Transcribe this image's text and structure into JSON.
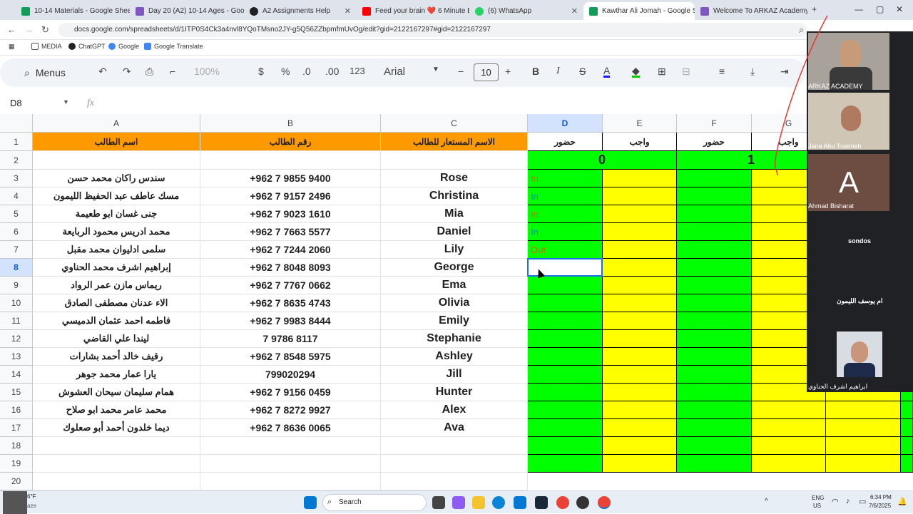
{
  "browser": {
    "tabs": [
      {
        "title": "10-14 Materials - Google Sheets",
        "color": "#0f9d58"
      },
      {
        "title": "Day 20 (A2) 10-14 Ages - Google",
        "color": "#7e57c2"
      },
      {
        "title": "A2 Assignments Help",
        "color": "#222222"
      },
      {
        "title": "Feed your brain ❤️ 6 Minute E",
        "color": "#ff0000"
      },
      {
        "title": "(6) WhatsApp",
        "color": "#25d366"
      },
      {
        "title": "Kawthar Ali Jomah - Google Sh",
        "color": "#0f9d58"
      },
      {
        "title": "Welcome To ARKAZ Academy",
        "color": "#7e57c2"
      }
    ],
    "url": "docs.google.com/spreadsheets/d/1ITP0S4Ck3a4nvl8YQoTMsno2JY-g5Q56ZZbpmfmUvOg/edit?gid=2122167297#gid=2122167297",
    "bookmarks": [
      "MEDIA",
      "ChatGPT",
      "Google",
      "Google Translate"
    ]
  },
  "toolbar": {
    "menus": "Menus",
    "zoom": "100%",
    "currency": "$",
    "percent": "%",
    "dec_less": ".0",
    "dec_more": ".00",
    "format123": "123",
    "font": "Arial",
    "font_size": "10"
  },
  "formula_bar": {
    "name_box": "D8",
    "fx": "fx"
  },
  "columns": [
    "A",
    "B",
    "C",
    "D",
    "E",
    "F",
    "G"
  ],
  "header_row": {
    "a": "اسم الطالب",
    "b": "رقم الطالب",
    "c": "الاسم المستعار للطالب",
    "d": "حضور",
    "e": "واجب",
    "f": "حضور",
    "g": "واجب"
  },
  "row2": {
    "session_0": "0",
    "session_1": "1"
  },
  "rows": [
    {
      "num": "3",
      "name": "سندس راكان محمد حسن",
      "phone": "+962 7 9855 9400",
      "nick": "Rose",
      "att": "In"
    },
    {
      "num": "4",
      "name": "مسك عاطف عبد الحفيظ الليمون",
      "phone": "+962 7 9157 2496",
      "nick": "Christina",
      "att": "In"
    },
    {
      "num": "5",
      "name": "جنى غسان ابو طعيمة",
      "phone": "+962 7 9023 1610",
      "nick": "Mia",
      "att": "In"
    },
    {
      "num": "6",
      "name": "محمد ادريس محمود الربايعة",
      "phone": "+962 7 7663 5577",
      "nick": "Daniel",
      "att": "In"
    },
    {
      "num": "7",
      "name": "سلمى ادليوان محمد مقبل",
      "phone": "+962 7 7244 2060",
      "nick": "Lily",
      "att": "Out"
    },
    {
      "num": "8",
      "name": "إبراهيم اشرف محمد الحناوي",
      "phone": "+962 7 8048 8093",
      "nick": "George",
      "att": ""
    },
    {
      "num": "9",
      "name": "ريماس مازن عمر الرواد",
      "phone": "+962 7 7767 0662",
      "nick": "Ema",
      "att": ""
    },
    {
      "num": "10",
      "name": "الاء عدنان مصطفى الصادق",
      "phone": "+962 7 8635 4743",
      "nick": "Olivia",
      "att": ""
    },
    {
      "num": "11",
      "name": "فاطمه احمد عثمان الدميسي",
      "phone": "+962 7 9983 8444",
      "nick": "Emily",
      "att": ""
    },
    {
      "num": "12",
      "name": "ليندا علي القاضي",
      "phone": "7 9786 8117",
      "nick": "Stephanie",
      "att": ""
    },
    {
      "num": "13",
      "name": "رقيف خالد أحمد بشارات",
      "phone": "+962 7 8548 5975",
      "nick": "Ashley",
      "att": ""
    },
    {
      "num": "14",
      "name": "يارا عمار محمد جوهر",
      "phone": "799020294",
      "nick": "Jill",
      "att": ""
    },
    {
      "num": "15",
      "name": "همام سليمان سيحان العشوش",
      "phone": "+962 7 9156 0459",
      "nick": "Hunter",
      "att": ""
    },
    {
      "num": "16",
      "name": "محمد عامر محمد ابو صلاح",
      "phone": "+962 7 8272 9927",
      "nick": "Alex",
      "att": ""
    },
    {
      "num": "17",
      "name": "ديما خلدون أحمد أبو صعلوك",
      "phone": "+962 7 8636 0065",
      "nick": "Ava",
      "att": ""
    },
    {
      "num": "18",
      "name": "",
      "phone": "",
      "nick": "",
      "att": ""
    },
    {
      "num": "19",
      "name": "",
      "phone": "",
      "nick": "",
      "att": ""
    },
    {
      "num": "20",
      "name": "",
      "phone": "",
      "nick": "",
      "att": ""
    }
  ],
  "video_call": {
    "participants": [
      {
        "name": "ARKAZ ACADEMY"
      },
      {
        "name": "Jana Abu Tuaimeh"
      },
      {
        "name": "Ahmad Bisharat",
        "initial": "A"
      },
      {
        "name": "sondos"
      },
      {
        "name": "ام يوسف الليمون"
      },
      {
        "name": "ابراهيم اشرف الحناوي"
      }
    ]
  },
  "taskbar": {
    "weather": "6°F",
    "weather_sub": "aze",
    "search": "Search",
    "lang": "ENG",
    "region": "US",
    "time": "6:34 PM",
    "date": "7/6/2025"
  },
  "colors": {
    "header_orange": "#ff9900",
    "attendance_green": "#00ff00",
    "homework_yellow": "#ffff00",
    "selection_blue": "#1a73e8"
  }
}
